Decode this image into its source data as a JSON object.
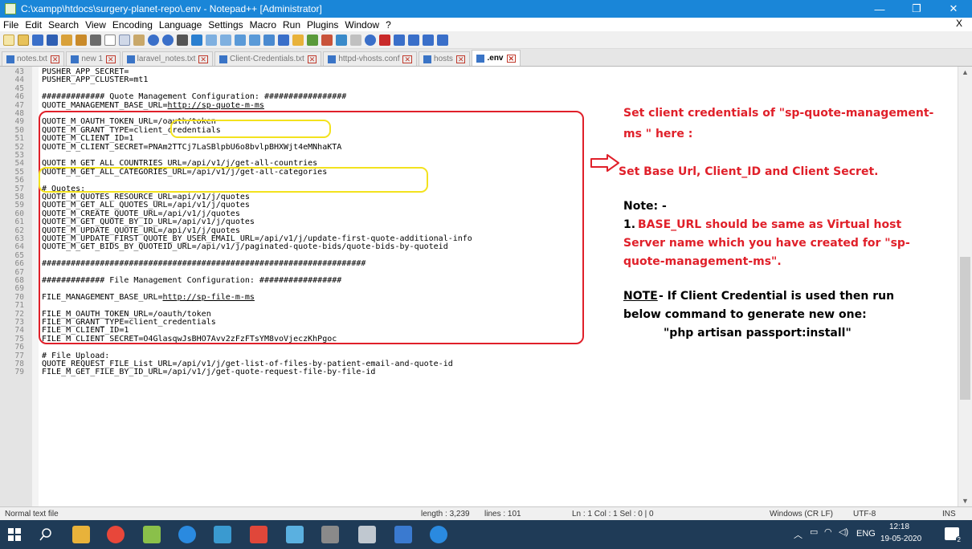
{
  "window": {
    "title": "C:\\xampp\\htdocs\\surgery-planet-repo\\.env - Notepad++ [Administrator]",
    "minimize": "—",
    "maximize": "❐",
    "close": "✕"
  },
  "menu": [
    "File",
    "Edit",
    "Search",
    "View",
    "Encoding",
    "Language",
    "Settings",
    "Macro",
    "Run",
    "Plugins",
    "Window",
    "?"
  ],
  "menu_close": "X",
  "tabs": [
    {
      "label": "notes.txt",
      "active": false
    },
    {
      "label": "new 1",
      "active": false
    },
    {
      "label": "laravel_notes.txt",
      "active": false
    },
    {
      "label": "Client-Credentials.txt",
      "active": false
    },
    {
      "label": "httpd-vhosts.conf",
      "active": false
    },
    {
      "label": "hosts",
      "active": false
    },
    {
      "label": ".env",
      "active": true
    }
  ],
  "editor": {
    "lines": [
      {
        "n": "43",
        "t": "PUSHER_APP_SECRET="
      },
      {
        "n": "44",
        "t": "PUSHER_APP_CLUSTER=mt1"
      },
      {
        "n": "45",
        "t": ""
      },
      {
        "n": "46",
        "t": "############# Quote Management Configuration: #################"
      },
      {
        "n": "47",
        "t": "QUOTE_MANAGEMENT_BASE_URL=",
        "u": "http://sp-quote-m-ms"
      },
      {
        "n": "48",
        "t": ""
      },
      {
        "n": "49",
        "t": "QUOTE_M_OAUTH_TOKEN_URL=/oauth/token"
      },
      {
        "n": "50",
        "t": "QUOTE_M_GRANT_TYPE=client_credentials"
      },
      {
        "n": "51",
        "t": "QUOTE_M_CLIENT_ID=1"
      },
      {
        "n": "52",
        "t": "QUOTE_M_CLIENT_SECRET=PNAm2TTCj7LaSBlpbU6o8bvlpBHXWjt4eMNhaKTA"
      },
      {
        "n": "53",
        "t": ""
      },
      {
        "n": "54",
        "t": "QUOTE_M_GET_ALL_COUNTRIES_URL=/api/v1/j/get-all-countries"
      },
      {
        "n": "55",
        "t": "QUOTE_M_GET_ALL_CATEGORIES_URL=/api/v1/j/get-all-categories"
      },
      {
        "n": "56",
        "t": ""
      },
      {
        "n": "57",
        "t": "# Quotes:"
      },
      {
        "n": "58",
        "t": "QUOTE_M_QUOTES_RESOURCE_URL=api/v1/j/quotes"
      },
      {
        "n": "59",
        "t": "QUOTE_M_GET_ALL_QUOTES_URL=/api/v1/j/quotes"
      },
      {
        "n": "60",
        "t": "QUOTE_M_CREATE_QUOTE_URL=/api/v1/j/quotes"
      },
      {
        "n": "61",
        "t": "QUOTE_M_GET_QUOTE_BY_ID_URL=/api/v1/j/quotes"
      },
      {
        "n": "62",
        "t": "QUOTE_M_UPDATE_QUOTE_URL=/api/v1/j/quotes"
      },
      {
        "n": "63",
        "t": "QUOTE_M_UPDATE_FIRST_QUOTE_BY_USER_EMAIL_URL=/api/v1/j/update-first-quote-additional-info"
      },
      {
        "n": "64",
        "t": "QUOTE_M_GET_BIDS_BY_QUOTEID_URL=/api/v1/j/paginated-quote-bids/quote-bids-by-quoteid"
      },
      {
        "n": "65",
        "t": ""
      },
      {
        "n": "66",
        "t": "###################################################################"
      },
      {
        "n": "67",
        "t": ""
      },
      {
        "n": "68",
        "t": "############# File Management Configuration: #################"
      },
      {
        "n": "69",
        "t": ""
      },
      {
        "n": "70",
        "t": "FILE_MANAGEMENT_BASE_URL=",
        "u": "http://sp-file-m-ms"
      },
      {
        "n": "71",
        "t": ""
      },
      {
        "n": "72",
        "t": "FILE_M_OAUTH_TOKEN_URL=/oauth/token"
      },
      {
        "n": "73",
        "t": "FILE_M_GRANT_TYPE=client_credentials"
      },
      {
        "n": "74",
        "t": "FILE_M_CLIENT_ID=1"
      },
      {
        "n": "75",
        "t": "FILE_M_CLIENT_SECRET=O4GlasqwJsBHO7Avv2zFzFTsYM8voVjeczKhPgoc"
      },
      {
        "n": "76",
        "t": ""
      },
      {
        "n": "77",
        "t": "# File Upload:"
      },
      {
        "n": "78",
        "t": "QUOTE_REQUEST_FILE_List_URL=/api/v1/j/get-list-of-files-by-patient-email-and-quote-id"
      },
      {
        "n": "79",
        "t": "FILE_M_GET_FILE_BY_ID_URL=/api/v1/j/get-quote-request-file-by-file-id"
      }
    ]
  },
  "annotations": {
    "heading_1": "Set client credentials of \"sp-quote-management-",
    "heading_2": "ms \" here :",
    "base_url_note": "Set Base Url, Client_ID and Client Secret.",
    "note_label": "Note: -",
    "point_1_number": "1.",
    "point_1_a": "BASE_URL should be same as Virtual host",
    "point_1_b": "Server name which you have created for \"sp-",
    "point_1_c": "quote-management-ms\".",
    "note2_label": "NOTE",
    "note2_a": "- If Client Credential is used then run",
    "note2_b": "below command to generate new one:",
    "command": "\"php artisan passport:install\""
  },
  "status": {
    "filetype": "Normal text file",
    "length": "length : 3,239",
    "lines": "lines : 101",
    "position": "Ln : 1   Col : 1   Sel : 0 | 0",
    "eol": "Windows (CR LF)",
    "encoding": "UTF-8",
    "mode": "INS"
  },
  "taskbar": {
    "lang": "ENG",
    "time": "12:18",
    "date": "19-05-2020",
    "notifications": "2"
  },
  "colors": {
    "titlebar": "#1a86d8",
    "annotation_red": "#e0202a",
    "highlight_yellow": "#f3e21e",
    "taskbar": "#1f3b57"
  }
}
